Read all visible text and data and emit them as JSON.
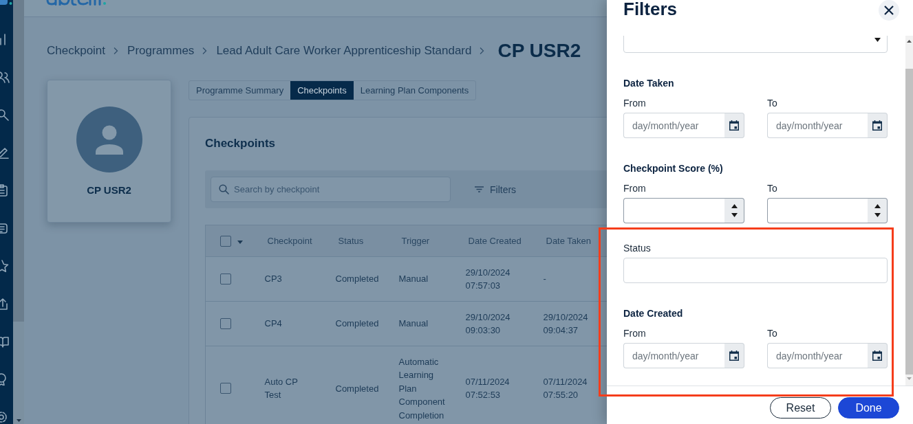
{
  "breadcrumb": {
    "items": [
      "Checkpoint",
      "Programmes",
      "Lead Adult Care Worker Apprenticeship Standard"
    ],
    "current": "CP USR2"
  },
  "profile": {
    "name": "CP USR2"
  },
  "tabs": [
    {
      "label": "Programme Summary",
      "selected": false
    },
    {
      "label": "Checkpoints",
      "selected": true
    },
    {
      "label": "Learning Plan Components",
      "selected": false
    }
  ],
  "checkpoints": {
    "title": "Checkpoints",
    "search": {
      "placeholder": "Search by checkpoint"
    },
    "filters_button": "Filters",
    "table": {
      "select_all": {
        "checked": false
      },
      "columns": [
        "Checkpoint",
        "Status",
        "Trigger",
        "Date Created",
        "Date Taken"
      ],
      "rows": [
        {
          "checked": false,
          "cells": [
            "CP3",
            "Completed",
            "Manual",
            "29/10/2024 07:57:03",
            "-"
          ]
        },
        {
          "checked": false,
          "cells": [
            "CP4",
            "Completed",
            "Manual",
            "29/10/2024 09:03:30",
            "29/10/2024 09:04:37"
          ]
        },
        {
          "checked": false,
          "cells": [
            "Auto CP Test",
            "Completed",
            "Automatic Learning Plan Component Completion",
            "07/11/2024 07:52:53",
            "07/11/2024 07:55:20"
          ]
        }
      ]
    }
  },
  "filters": {
    "title": "Filters",
    "sections": [
      {
        "kind": "select"
      },
      {
        "kind": "date_range",
        "label": "Date Taken",
        "from": {
          "label": "From",
          "placeholder": "day/month/year"
        },
        "to": {
          "label": "To",
          "placeholder": "day/month/year"
        }
      },
      {
        "kind": "number_range",
        "label": "Checkpoint Score (%)",
        "from": {
          "label": "From"
        },
        "to": {
          "label": "To"
        }
      },
      {
        "kind": "text",
        "label": "Status"
      },
      {
        "kind": "date_range",
        "label": "Date Created",
        "from": {
          "label": "From",
          "placeholder": "day/month/year"
        },
        "to": {
          "label": "To",
          "placeholder": "day/month/year"
        }
      }
    ],
    "buttons": [
      {
        "kind": "secondary",
        "label": "Reset"
      },
      {
        "kind": "primary",
        "label": "Done"
      }
    ]
  }
}
